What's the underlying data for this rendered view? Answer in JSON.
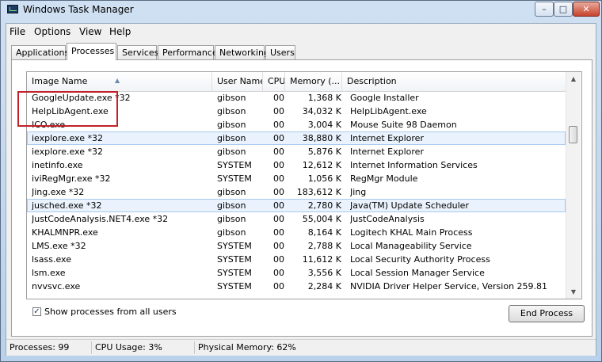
{
  "window": {
    "title": "Windows Task Manager",
    "minimize_glyph": "–",
    "maximize_glyph": "□",
    "close_glyph": "✕"
  },
  "menu": [
    "File",
    "Options",
    "View",
    "Help"
  ],
  "tabs": [
    "Applications",
    "Processes",
    "Services",
    "Performance",
    "Networking",
    "Users"
  ],
  "active_tab": "Processes",
  "columns": [
    "Image Name",
    "User Name",
    "CPU",
    "Memory (...",
    "Description"
  ],
  "sort_indicator": "▲",
  "processes": [
    {
      "name": "GoogleUpdate.exe *32",
      "user": "gibson",
      "cpu": "00",
      "memory": "1,368 K",
      "description": "Google Installer"
    },
    {
      "name": "HelpLibAgent.exe",
      "user": "gibson",
      "cpu": "00",
      "memory": "34,032 K",
      "description": "HelpLibAgent.exe"
    },
    {
      "name": "ICO.exe",
      "user": "gibson",
      "cpu": "00",
      "memory": "3,004 K",
      "description": "Mouse Suite 98 Daemon"
    },
    {
      "name": "iexplore.exe *32",
      "user": "gibson",
      "cpu": "00",
      "memory": "38,880 K",
      "description": "Internet Explorer",
      "selected": true
    },
    {
      "name": "iexplore.exe *32",
      "user": "gibson",
      "cpu": "00",
      "memory": "5,876 K",
      "description": "Internet Explorer"
    },
    {
      "name": "inetinfo.exe",
      "user": "SYSTEM",
      "cpu": "00",
      "memory": "12,612 K",
      "description": "Internet Information Services"
    },
    {
      "name": "iviRegMgr.exe *32",
      "user": "SYSTEM",
      "cpu": "00",
      "memory": "1,056 K",
      "description": "RegMgr Module"
    },
    {
      "name": "Jing.exe *32",
      "user": "gibson",
      "cpu": "00",
      "memory": "183,612 K",
      "description": "Jing"
    },
    {
      "name": "jusched.exe *32",
      "user": "gibson",
      "cpu": "00",
      "memory": "2,780 K",
      "description": "Java(TM) Update Scheduler",
      "selected": true
    },
    {
      "name": "JustCodeAnalysis.NET4.exe *32",
      "user": "gibson",
      "cpu": "00",
      "memory": "55,004 K",
      "description": "JustCodeAnalysis"
    },
    {
      "name": "KHALMNPR.exe",
      "user": "gibson",
      "cpu": "00",
      "memory": "8,164 K",
      "description": "Logitech KHAL Main Process"
    },
    {
      "name": "LMS.exe *32",
      "user": "SYSTEM",
      "cpu": "00",
      "memory": "2,788 K",
      "description": "Local Manageability Service"
    },
    {
      "name": "lsass.exe",
      "user": "SYSTEM",
      "cpu": "00",
      "memory": "11,612 K",
      "description": "Local Security Authority Process"
    },
    {
      "name": "lsm.exe",
      "user": "SYSTEM",
      "cpu": "00",
      "memory": "3,556 K",
      "description": "Local Session Manager Service"
    },
    {
      "name": "nvvsvc.exe",
      "user": "SYSTEM",
      "cpu": "00",
      "memory": "2,284 K",
      "description": "NVIDIA Driver Helper Service, Version 259.81"
    }
  ],
  "show_all": {
    "label": "Show processes from all users",
    "checked": true,
    "check_glyph": "✓"
  },
  "end_process_label": "End Process",
  "status": {
    "processes": "Processes: 99",
    "cpu": "CPU Usage: 3%",
    "memory": "Physical Memory: 62%"
  }
}
